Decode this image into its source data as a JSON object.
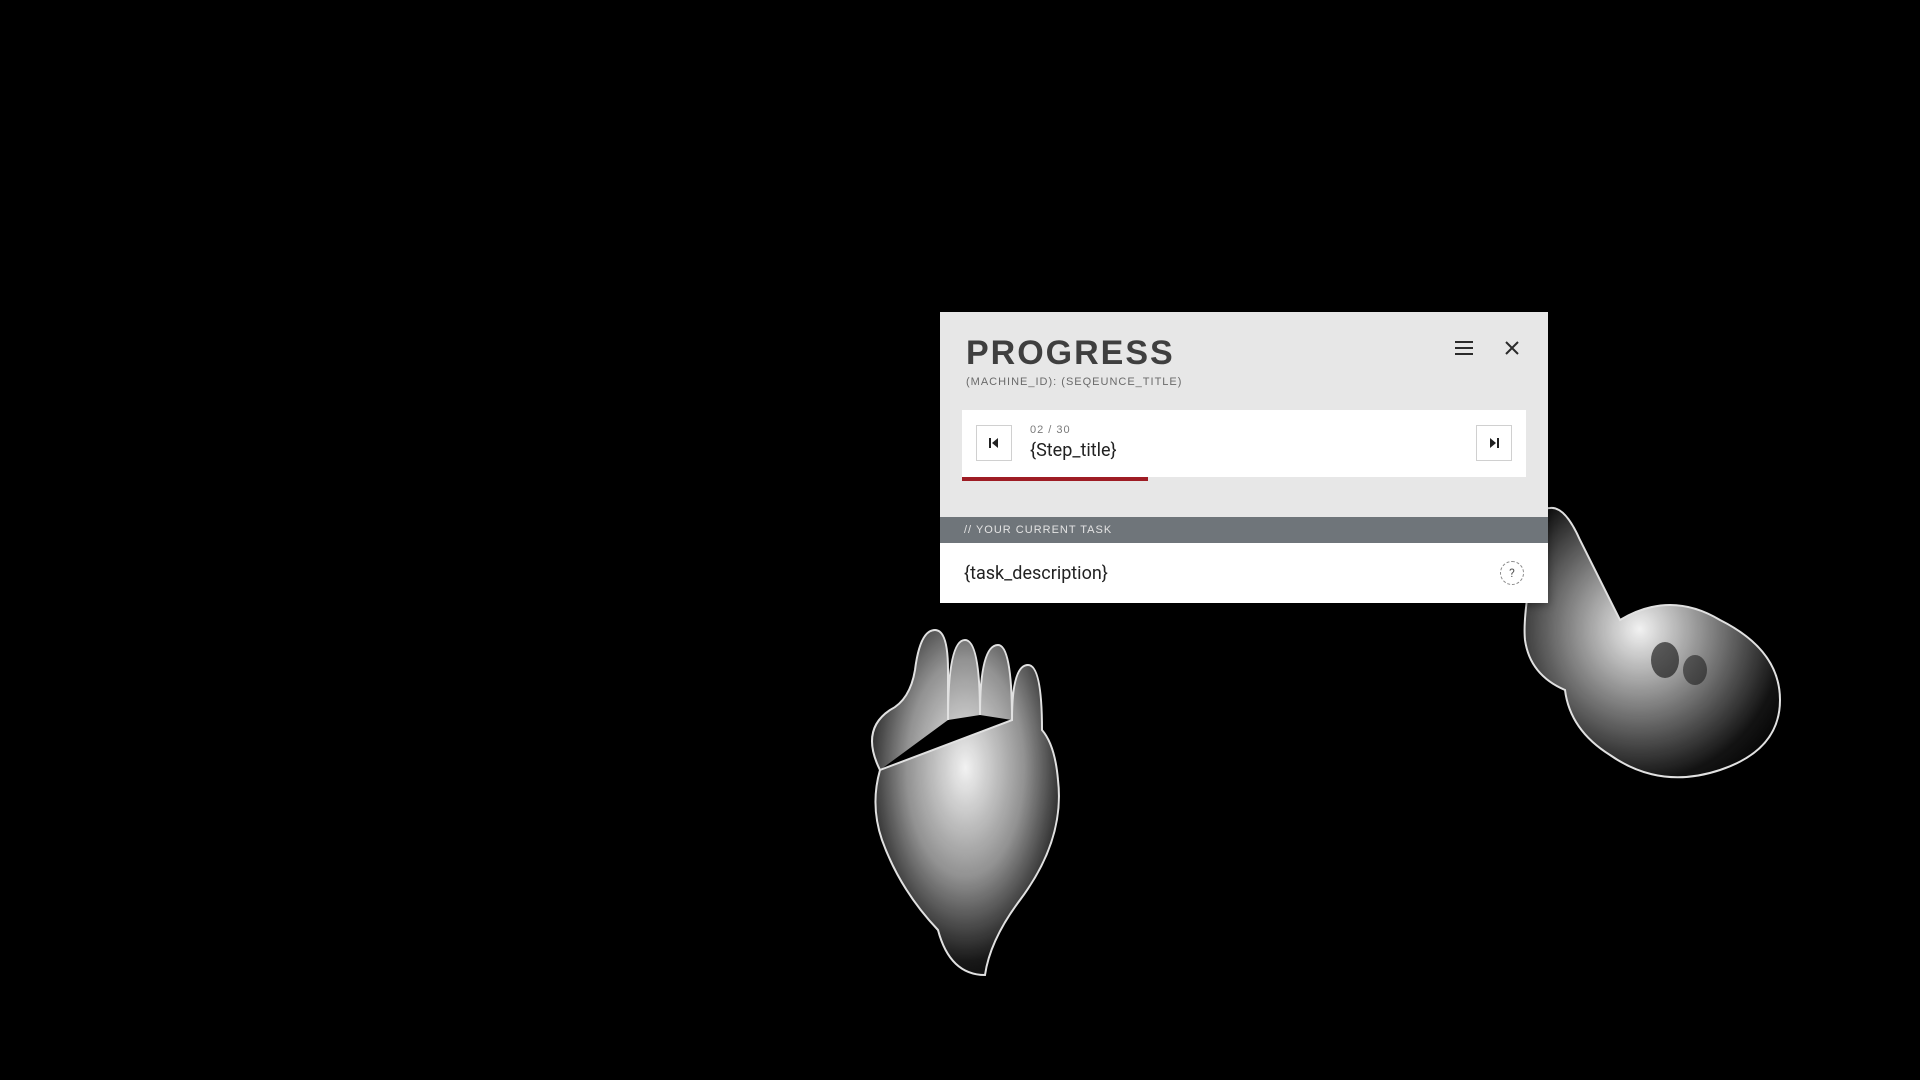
{
  "panel": {
    "title": "PROGRESS",
    "subtitle": "(MACHINE_ID): (SEQEUNCE_TITLE)"
  },
  "step": {
    "count": "02 / 30",
    "title": "{Step_title}",
    "progress_percent": 33
  },
  "task": {
    "bar_label": "// YOUR CURRENT TASK",
    "description": "{task_description}",
    "help_label": "?"
  },
  "colors": {
    "accent": "#9e1c24",
    "panel_bg": "#e7e7e7",
    "task_bar_bg": "#6f757a"
  }
}
